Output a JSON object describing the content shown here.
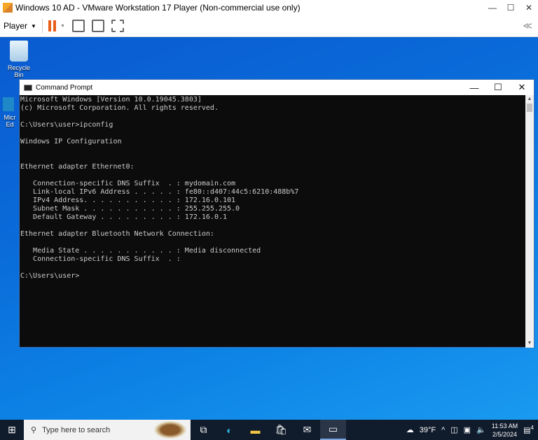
{
  "window": {
    "title": "Windows 10 AD - VMware Workstation 17 Player (Non-commercial use only)"
  },
  "toolbar": {
    "player_label": "Player"
  },
  "desktop": {
    "icons": [
      {
        "label": "Recycle Bin"
      },
      {
        "label": "Micr Ed"
      }
    ]
  },
  "cmd": {
    "title": "Command Prompt",
    "lines": [
      "Microsoft Windows [Version 10.0.19045.3803]",
      "(c) Microsoft Corporation. All rights reserved.",
      "",
      "C:\\Users\\user>ipconfig",
      "",
      "Windows IP Configuration",
      "",
      "",
      "Ethernet adapter Ethernet0:",
      "",
      "   Connection-specific DNS Suffix  . : mydomain.com",
      "   Link-local IPv6 Address . . . . . : fe80::d407:44c5:6210:488b%7",
      "   IPv4 Address. . . . . . . . . . . : 172.16.0.101",
      "   Subnet Mask . . . . . . . . . . . : 255.255.255.0",
      "   Default Gateway . . . . . . . . . : 172.16.0.1",
      "",
      "Ethernet adapter Bluetooth Network Connection:",
      "",
      "   Media State . . . . . . . . . . . : Media disconnected",
      "   Connection-specific DNS Suffix  . :",
      "",
      "C:\\Users\\user>"
    ]
  },
  "taskbar": {
    "search_placeholder": "Type here to search",
    "weather": "39°F",
    "time": "11:53 AM",
    "date": "2/5/2024",
    "notifications": "4"
  }
}
